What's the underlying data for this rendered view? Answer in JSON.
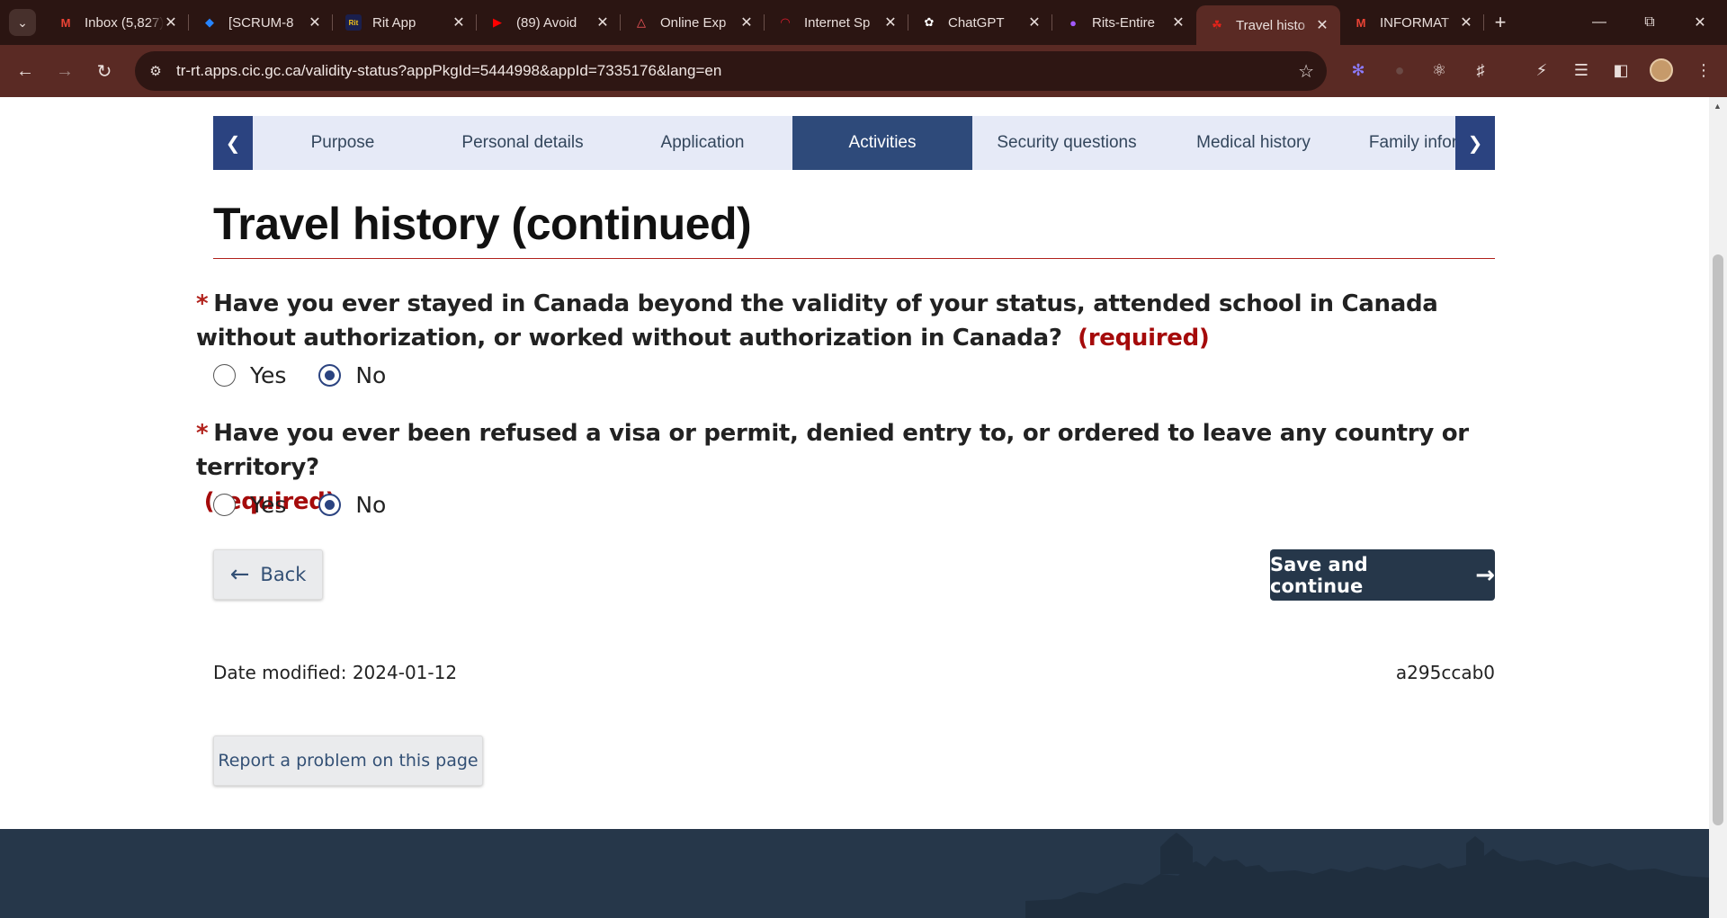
{
  "browser": {
    "tabs": [
      {
        "title": "Inbox (5,827)",
        "icon": "gmail-icon",
        "color": "#ea4335"
      },
      {
        "title": "[SCRUM-8",
        "icon": "jira-icon",
        "color": "#2684ff"
      },
      {
        "title": "Rit App",
        "icon": "rit-app-icon",
        "color": "#f5c518"
      },
      {
        "title": "(89) Avoid",
        "icon": "youtube-icon",
        "color": "#ff0000"
      },
      {
        "title": "Online Exp",
        "icon": "airbnb-icon",
        "color": "#ff5a5f"
      },
      {
        "title": "Internet Sp",
        "icon": "speedtest-icon",
        "color": "#e11d2e"
      },
      {
        "title": "ChatGPT",
        "icon": "chatgpt-icon",
        "color": "#ffffff"
      },
      {
        "title": "Rits-Entire",
        "icon": "figma-icon",
        "color": "#a259ff"
      },
      {
        "title": "Travel histo",
        "icon": "maple-leaf-icon",
        "color": "#e2231a",
        "active": true
      },
      {
        "title": "INFORMAT",
        "icon": "gmail-icon",
        "color": "#ea4335"
      }
    ],
    "url": "tr-rt.apps.cic.gc.ca/validity-status?appPkgId=5444998&appId=7335176&lang=en"
  },
  "stepnav": {
    "steps": [
      "Purpose",
      "Personal details",
      "Application",
      "Activities",
      "Security questions",
      "Medical history",
      "Family infor"
    ],
    "active_index": 3
  },
  "page": {
    "title": "Travel history (continued)",
    "questions": [
      {
        "text": "Have you ever stayed in Canada beyond the validity of your status, attended school in Canada without authorization, or worked without authorization in Canada?",
        "required_label": "(required)",
        "options": [
          "Yes",
          "No"
        ],
        "selected": "No"
      },
      {
        "text": "Have you ever been refused a visa or permit, denied entry to, or ordered to leave any country or territory?",
        "required_label": "(required)",
        "options": [
          "Yes",
          "No"
        ],
        "selected": "No"
      }
    ],
    "back_label": "Back",
    "save_label": "Save and continue",
    "date_modified": "Date modified: 2024-01-12",
    "version": "a295ccab0",
    "report_label": "Report a problem on this page"
  },
  "colors": {
    "chrome_dark": "#2b1512",
    "chrome_toolbar": "#5a2a24",
    "gc_blue": "#2e4a7a",
    "gc_navy": "#26374a",
    "required_red": "#a50b0b",
    "rule_red": "#b1211b"
  }
}
